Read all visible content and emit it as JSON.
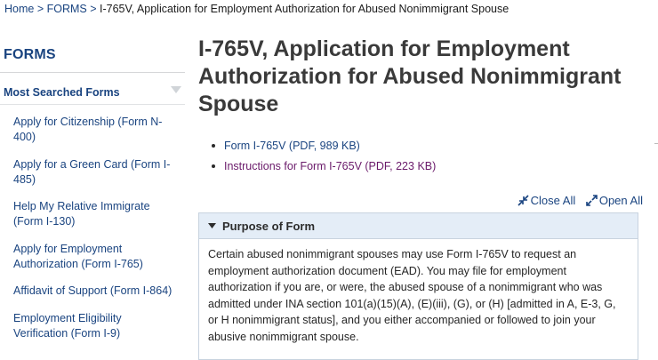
{
  "breadcrumb": {
    "home": "Home",
    "sep": " > ",
    "forms": "FORMS",
    "current": "I-765V, Application for Employment Authorization for Abused Nonimmigrant Spouse"
  },
  "sidebar": {
    "title": "FORMS",
    "section": "Most Searched Forms",
    "items": [
      {
        "label": "Apply for Citizenship (Form N-400)"
      },
      {
        "label": "Apply for a Green Card (Form I-485)"
      },
      {
        "label": "Help My Relative Immigrate (Form I-130)"
      },
      {
        "label": "Apply for Employment Authorization (Form I-765)"
      },
      {
        "label": "Affidavit of Support (Form I-864)"
      },
      {
        "label": "Employment Eligibility Verification (Form I-9)"
      }
    ]
  },
  "main": {
    "title": "I-765V, Application for Employment Authorization for Abused Nonimmigrant Spouse",
    "documents": [
      {
        "label": "Form I-765V (PDF, 989 KB)"
      },
      {
        "label": "Instructions for Form I-765V (PDF, 223 KB)"
      }
    ],
    "close_all": "Close All",
    "open_all": "Open All",
    "accordion": {
      "title": "Purpose of Form",
      "body": "Certain abused nonimmigrant spouses may use Form I-765V to request an employment authorization document (EAD). You may file for employment authorization if you are, or were, the abused spouse of a nonimmigrant who was admitted under INA section 101(a)(15)(A), (E)(iii), (G), or (H) [admitted in A, E-3, G, or H nonimmigrant status], and you either accompanied or followed to join your abusive nonimmigrant spouse."
    }
  },
  "colors": {
    "link": "#1a4480",
    "visited_link": "#6a1a6a",
    "accordion_header_bg": "#e4edf7",
    "heading": "#3a3a3a"
  }
}
